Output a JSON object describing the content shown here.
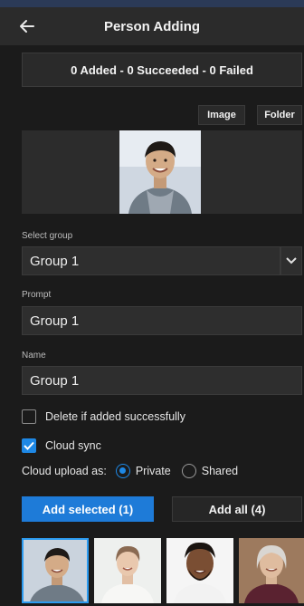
{
  "header": {
    "title": "Person Adding"
  },
  "status": {
    "text": "0 Added - 0 Succeeded - 0 Failed"
  },
  "source_buttons": {
    "image": "Image",
    "folder": "Folder"
  },
  "group": {
    "label": "Select group",
    "value": "Group 1"
  },
  "prompt": {
    "label": "Prompt",
    "value": "Group 1"
  },
  "name": {
    "label": "Name",
    "value": "Group 1"
  },
  "options": {
    "delete_label": "Delete if added successfully",
    "delete_checked": false,
    "cloud_sync_label": "Cloud sync",
    "cloud_sync_checked": true
  },
  "upload": {
    "label": "Cloud upload as:",
    "private": "Private",
    "shared": "Shared",
    "selected": "Private"
  },
  "actions": {
    "add_selected": "Add selected (1)",
    "add_all": "Add all (4)"
  },
  "thumbnails": [
    {
      "icon": "person-photo-1",
      "selected": true
    },
    {
      "icon": "person-photo-2",
      "selected": false
    },
    {
      "icon": "person-photo-3",
      "selected": false
    },
    {
      "icon": "person-photo-4",
      "selected": false
    }
  ],
  "colors": {
    "accent": "#1e7bd8",
    "background": "#1b1b1b",
    "header": "#2b2b2b"
  }
}
